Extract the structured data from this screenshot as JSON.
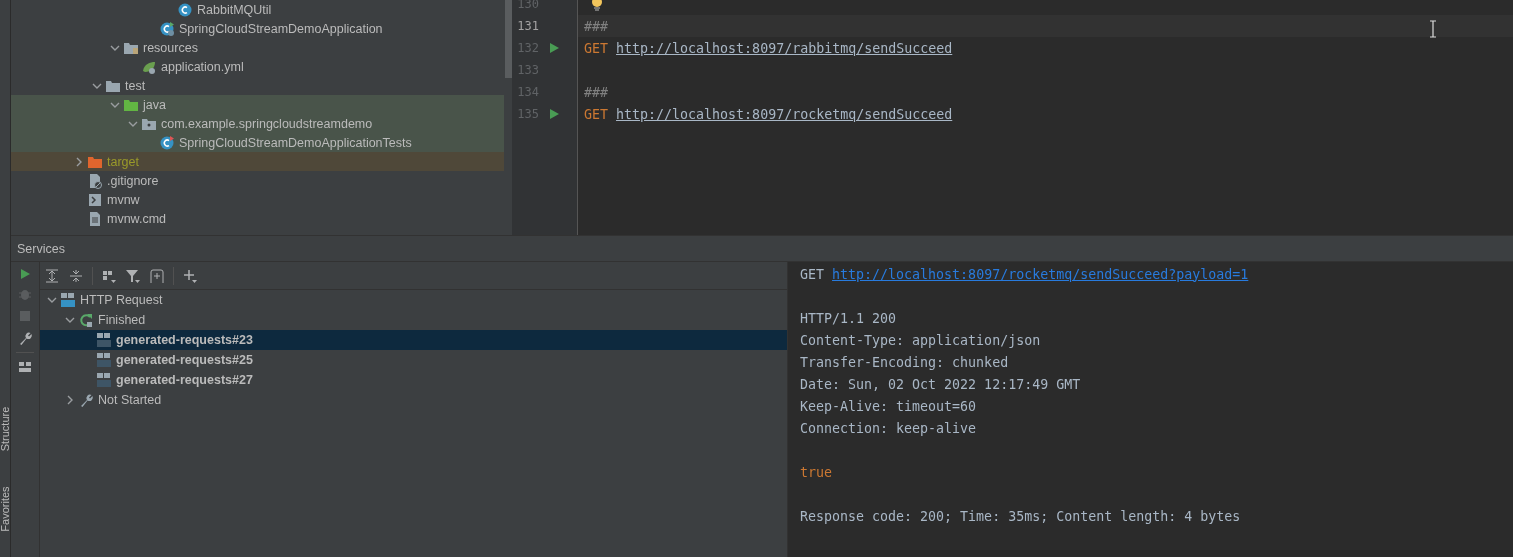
{
  "project_tree": [
    {
      "children": [
        {
          "children": [
            {
              "children": [
                {
                  "children": [
                    {
                      "children": [
                        {
                          "label": "RabbitMQUtil",
                          "kind": "class"
                        }
                      ]
                    },
                    {
                      "label": "SpringCloudStreamDemoApplication",
                      "kind": "spring-class"
                    }
                  ]
                }
              ]
            },
            {
              "label": "resources",
              "kind": "resources-folder",
              "expanded": true,
              "children": [
                {
                  "label": "application.yml",
                  "kind": "yaml"
                }
              ]
            }
          ]
        },
        {
          "label": "test",
          "kind": "folder",
          "expanded": true,
          "children": [
            {
              "label": "java",
              "kind": "test-folder",
              "expanded": true,
              "color": "#49544a",
              "children": [
                {
                  "label": "com.example.springcloudstreamdemo",
                  "kind": "package",
                  "expanded": true,
                  "color": "#49544a",
                  "children": [
                    {
                      "label": "SpringCloudStreamDemoApplicationTests",
                      "kind": "test-class",
                      "color": "#49544a"
                    }
                  ]
                }
              ]
            }
          ]
        }
      ]
    },
    {
      "label": "target",
      "kind": "excluded-folder",
      "expanded": false,
      "color": "#4f4839"
    },
    {
      "label": ".gitignore",
      "kind": "ignore-file"
    },
    {
      "label": "mvnw",
      "kind": "script"
    },
    {
      "label": "mvnw.cmd",
      "kind": "text-file"
    }
  ],
  "editor": {
    "lines": [
      {
        "number": "130",
        "current": false,
        "runnable": false,
        "intention": true
      },
      {
        "number": "131",
        "current": true,
        "runnable": false,
        "intention": false,
        "tokens": [
          {
            "kind": "comment",
            "text": "###"
          }
        ]
      },
      {
        "number": "132",
        "current": false,
        "runnable": true,
        "intention": false,
        "tokens": [
          {
            "kind": "method",
            "text": "GET"
          },
          {
            "kind": "url",
            "text": "http://localhost:8097/rabbitmq/sendSucceed"
          }
        ]
      },
      {
        "number": "133",
        "current": false,
        "runnable": false,
        "intention": false
      },
      {
        "number": "134",
        "current": false,
        "runnable": false,
        "intention": false,
        "tokens": [
          {
            "kind": "comment",
            "text": "###"
          }
        ]
      },
      {
        "number": "135",
        "current": false,
        "runnable": true,
        "intention": false,
        "tokens": [
          {
            "kind": "method",
            "text": "GET"
          },
          {
            "kind": "url",
            "text": "http://localhost:8097/rocketmq/sendSucceed"
          }
        ]
      }
    ]
  },
  "tool_windows": [
    {
      "label": "Structure"
    },
    {
      "label": "Favorites"
    }
  ],
  "services": {
    "title": "Services",
    "tree": [
      {
        "label": "HTTP Request",
        "kind": "api-group",
        "expanded": true,
        "children": [
          {
            "label": "Finished",
            "kind": "finished",
            "expanded": true,
            "children": [
              {
                "label": "generated-requests#23",
                "kind": "request",
                "selected": true
              },
              {
                "label": "generated-requests#25",
                "kind": "request",
                "selected": false
              },
              {
                "label": "generated-requests#27",
                "kind": "request",
                "selected": false
              }
            ]
          },
          {
            "label": "Not Started",
            "kind": "not-started",
            "expanded": false
          }
        ]
      }
    ],
    "output": [
      {
        "kind": "request",
        "method": "GET",
        "url": "http://localhost:8097/rocketmq/sendSucceed?payload=1"
      },
      {
        "kind": "blank"
      },
      {
        "kind": "text",
        "text": "HTTP/1.1 200"
      },
      {
        "kind": "text",
        "text": "Content-Type: application/json"
      },
      {
        "kind": "text",
        "text": "Transfer-Encoding: chunked"
      },
      {
        "kind": "text",
        "text": "Date: Sun, 02 Oct 2022 12:17:49 GMT"
      },
      {
        "kind": "text",
        "text": "Keep-Alive: timeout=60"
      },
      {
        "kind": "text",
        "text": "Connection: keep-alive"
      },
      {
        "kind": "blank"
      },
      {
        "kind": "value",
        "text": "true"
      },
      {
        "kind": "blank"
      },
      {
        "kind": "text",
        "text": "Response code: 200; Time: 35ms; Content length: 4 bytes"
      }
    ]
  }
}
